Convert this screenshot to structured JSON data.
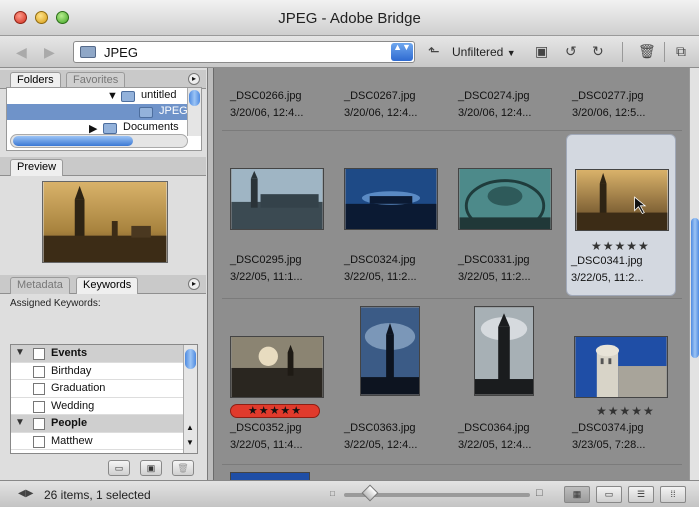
{
  "window": {
    "title": "JPEG - Adobe Bridge"
  },
  "toolbar": {
    "path": "JPEG",
    "filter": "Unfiltered",
    "filter_arrow": "▼",
    "path_arrows": "▲▼"
  },
  "left_panel": {
    "top_tabs": [
      "Folders",
      "Favorites"
    ],
    "folders": [
      {
        "label": "untitled",
        "selected": false
      },
      {
        "label": "JPEG",
        "selected": true
      },
      {
        "label": "Documents",
        "selected": false
      }
    ],
    "preview_tab": "Preview",
    "bottom_tabs": [
      "Metadata",
      "Keywords"
    ],
    "assigned_keywords_label": "Assigned Keywords:",
    "keywords": [
      {
        "label": "Events",
        "category": true
      },
      {
        "label": "Birthday",
        "category": false
      },
      {
        "label": "Graduation",
        "category": false
      },
      {
        "label": "Wedding",
        "category": false
      },
      {
        "label": "People",
        "category": true
      },
      {
        "label": "Matthew",
        "category": false
      }
    ]
  },
  "files": [
    {
      "name": "_DSC0266.jpg",
      "date": "3/20/06, 12:4..."
    },
    {
      "name": "_DSC0267.jpg",
      "date": "3/20/06, 12:4..."
    },
    {
      "name": "_DSC0274.jpg",
      "date": "3/20/06, 12:4..."
    },
    {
      "name": "_DSC0277.jpg",
      "date": "3/20/06, 12:5..."
    },
    {
      "name": "_DSC0295.jpg",
      "date": "3/22/05, 11:1..."
    },
    {
      "name": "_DSC0324.jpg",
      "date": "3/22/05, 11:2..."
    },
    {
      "name": "_DSC0331.jpg",
      "date": "3/22/05, 11:2..."
    },
    {
      "name": "_DSC0341.jpg",
      "date": "3/22/05, 11:2...",
      "stars": "★★★★★",
      "selected": true
    },
    {
      "name": "_DSC0352.jpg",
      "date": "3/22/05, 11:4...",
      "stars": "★★★★★",
      "label_color": "#e03a2c"
    },
    {
      "name": "_DSC0363.jpg",
      "date": "3/22/05, 12:4..."
    },
    {
      "name": "_DSC0364.jpg",
      "date": "3/22/05, 12:4..."
    },
    {
      "name": "_DSC0374.jpg",
      "date": "3/23/05, 7:28...",
      "stars": "★★★★★"
    }
  ],
  "status": {
    "text": "26 items, 1 selected"
  },
  "colors": {
    "selection": "#6f93c9",
    "accent": "#3b78d4",
    "content_bg": "#8e8e8e"
  }
}
